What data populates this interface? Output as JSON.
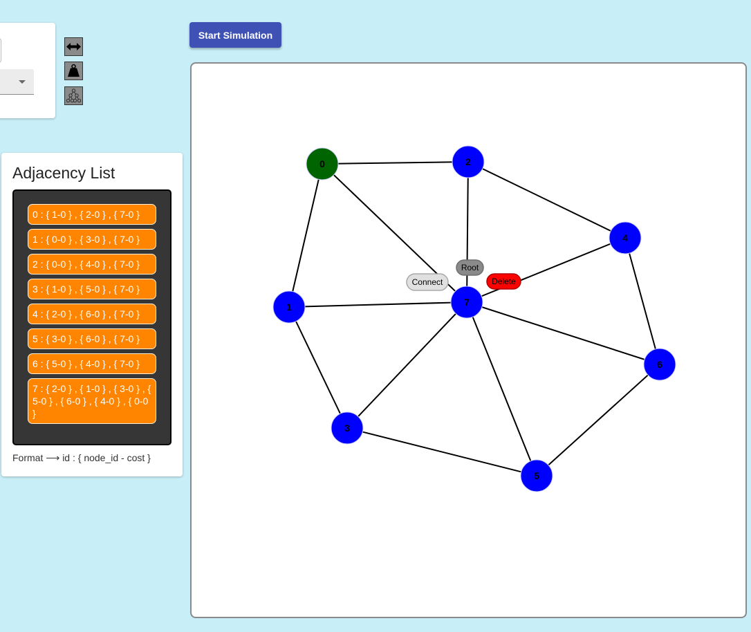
{
  "toolbar": {
    "start_label": "Start Simulation",
    "tools": [
      "resize-horizontal-icon",
      "weight-icon",
      "tree-icon"
    ]
  },
  "adjacency": {
    "title": "Adjacency List",
    "items": [
      "0 : { 1-0 } , { 2-0 } , { 7-0 }",
      "1 : { 0-0 } , { 3-0 } , { 7-0 }",
      "2 : { 0-0 } , { 4-0 } , { 7-0 }",
      "3 : { 1-0 } , { 5-0 } , { 7-0 }",
      "4 : { 2-0 } , { 6-0 } , { 7-0 }",
      "5 : { 3-0 } , { 6-0 } , { 7-0 }",
      "6 : { 5-0 } , { 4-0 } , { 7-0 }",
      "7 : { 2-0 } , { 1-0 } , { 3-0 } , { 5-0 } , { 6-0 } , { 4-0 } , { 0-0 }"
    ],
    "format": "Format ⟶ id : { node_id - cost }"
  },
  "graph": {
    "nodes": [
      {
        "id": "0",
        "color": "#006400"
      },
      {
        "id": "1",
        "color": "#0000ff"
      },
      {
        "id": "2",
        "color": "#0000ff"
      },
      {
        "id": "3",
        "color": "#0000ff"
      },
      {
        "id": "4",
        "color": "#0000ff"
      },
      {
        "id": "5",
        "color": "#0000ff"
      },
      {
        "id": "6",
        "color": "#0000ff"
      },
      {
        "id": "7",
        "color": "#0000ff"
      }
    ],
    "edges": [
      [
        "0",
        "1"
      ],
      [
        "0",
        "2"
      ],
      [
        "0",
        "7"
      ],
      [
        "1",
        "3"
      ],
      [
        "1",
        "7"
      ],
      [
        "2",
        "4"
      ],
      [
        "2",
        "7"
      ],
      [
        "3",
        "5"
      ],
      [
        "3",
        "7"
      ],
      [
        "4",
        "6"
      ],
      [
        "4",
        "7"
      ],
      [
        "5",
        "6"
      ],
      [
        "5",
        "7"
      ],
      [
        "6",
        "7"
      ]
    ],
    "context_menu": {
      "root_label": "Root",
      "connect_label": "Connect",
      "delete_label": "Delete",
      "delete_color": "#ff0000"
    }
  }
}
